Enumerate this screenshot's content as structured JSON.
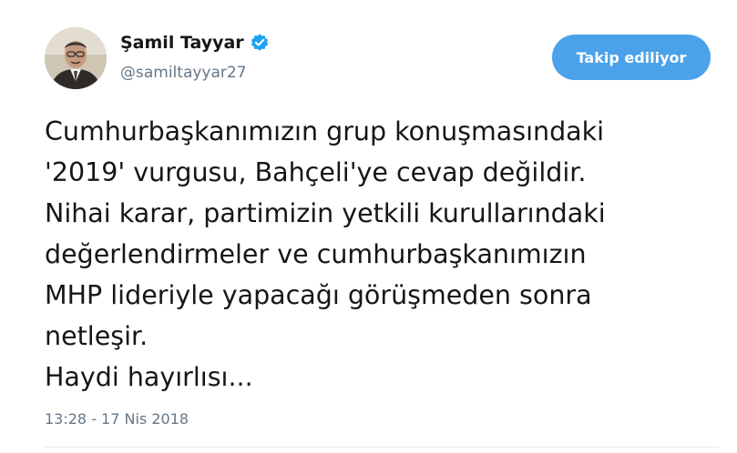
{
  "author": {
    "display_name": "Şamil Tayyar",
    "handle": "@samiltayyar27",
    "verified_icon": "verified-badge-icon",
    "avatar_icon": "profile-avatar"
  },
  "follow_button": {
    "label": "Takip ediliyor"
  },
  "tweet": {
    "lines": [
      "Cumhurbaşkanımızın grup konuşmasındaki",
      "'2019' vurgusu, Bahçeli'ye cevap değildir.",
      "Nihai karar, partimizin yetkili kurullarındaki",
      "değerlendirmeler ve cumhurbaşkanımızın",
      "MHP lideriyle yapacağı görüşmeden sonra",
      "netleşir.",
      "Haydi hayırlısı..."
    ],
    "timestamp": "13:28 - 17 Nis 2018"
  },
  "colors": {
    "accent": "#4ba2eb",
    "verified": "#1da1f2",
    "secondary_text": "#657786",
    "primary_text": "#14171a"
  }
}
